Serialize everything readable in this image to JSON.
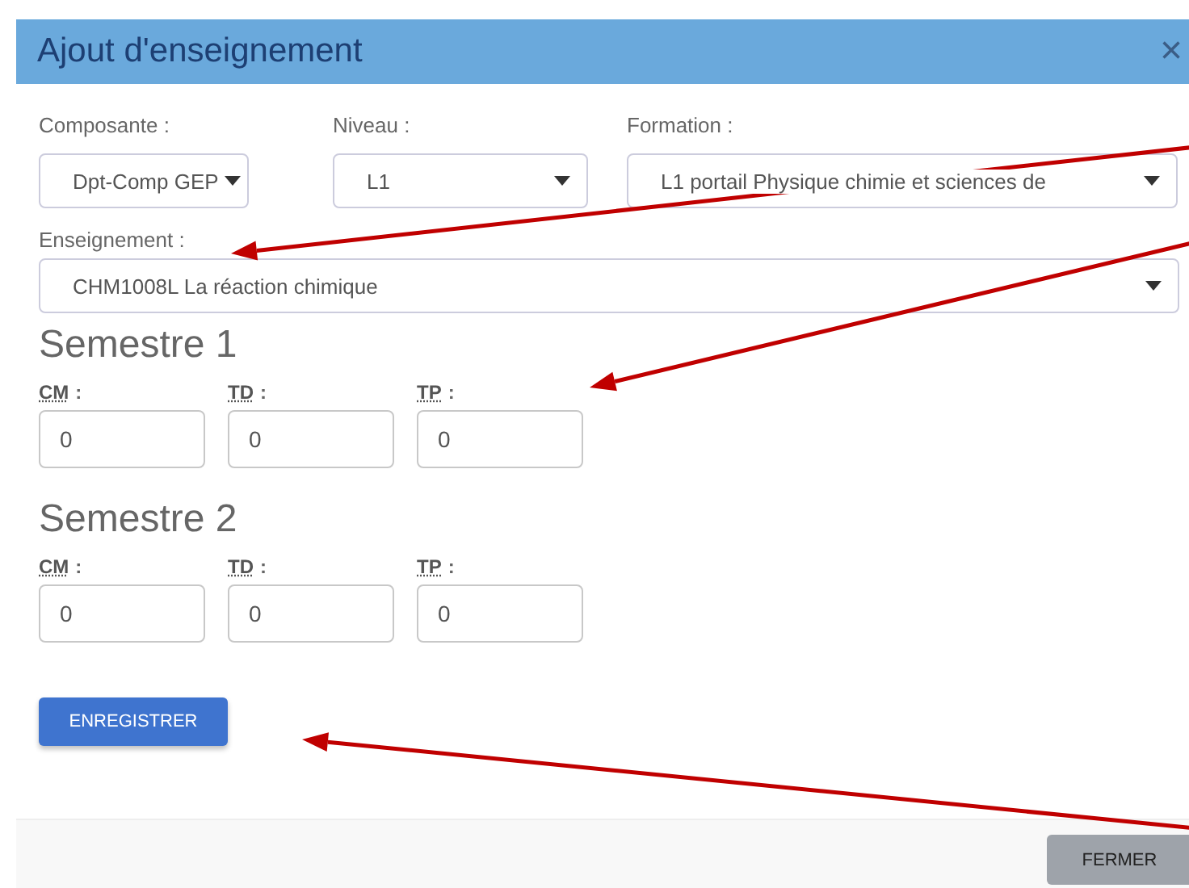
{
  "window": {
    "title": "Ajout d'enseignement",
    "close": "×"
  },
  "selects": [
    {
      "label": "Composante :",
      "value": "Dpt-Comp GEP"
    },
    {
      "label": "Niveau :",
      "value": "L1"
    },
    {
      "label": "Formation :",
      "value": "L1 portail Physique chimie et sciences de"
    }
  ],
  "course": {
    "label": "Enseignement :",
    "value": "CHM1008L La réaction chimique"
  },
  "semesters": [
    {
      "title": "Semestre 1",
      "fields": [
        {
          "label": "CM",
          "value": "0"
        },
        {
          "label": "TD",
          "value": "0"
        },
        {
          "label": "TP",
          "value": "0"
        }
      ]
    },
    {
      "title": "Semestre 2",
      "fields": [
        {
          "label": "CM",
          "value": "0"
        },
        {
          "label": "TD",
          "value": "0"
        },
        {
          "label": "TP",
          "value": "0"
        }
      ]
    }
  ],
  "colon": ":",
  "save_button": "ENREGISTRER",
  "close_button": "FERMER"
}
